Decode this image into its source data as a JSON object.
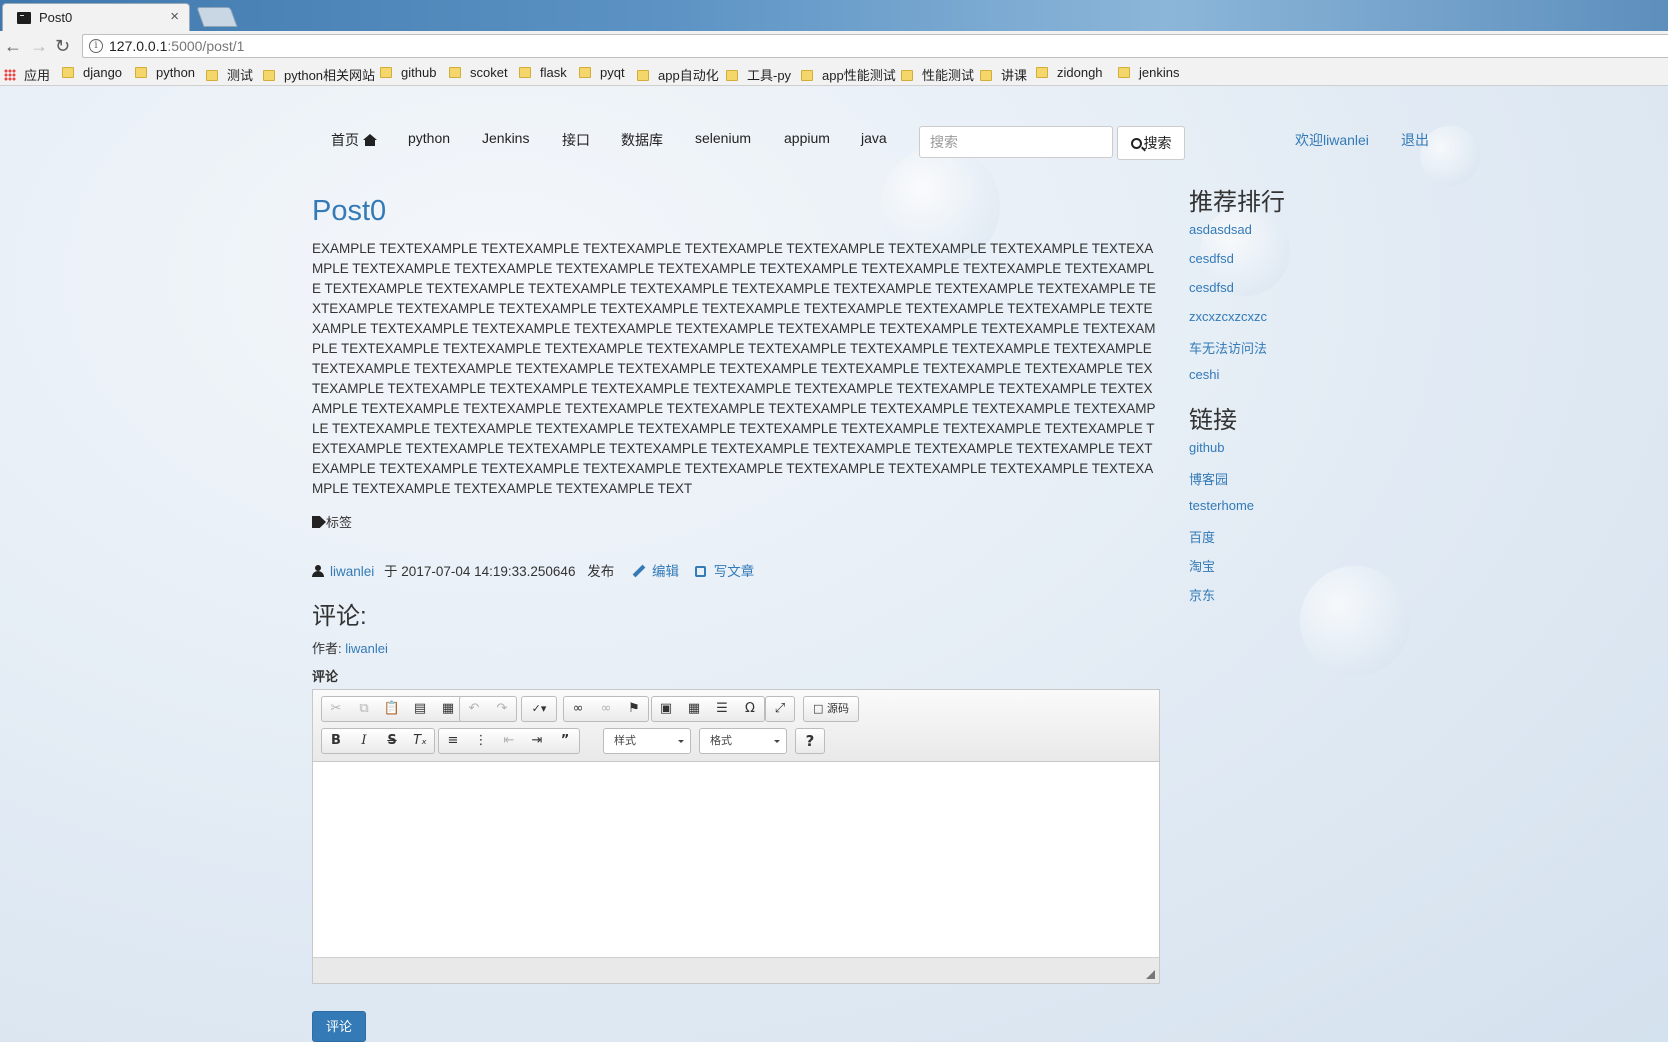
{
  "browser": {
    "tab_title": "Post0",
    "tab_close": "×",
    "url_host": "127.0.0.1",
    "url_path": ":5000/post/1",
    "bookmarks": [
      "应用",
      "django",
      "python",
      "测试",
      "python相关网站",
      "github",
      "scoket",
      "flask",
      "pyqt",
      "app自动化",
      "工具-py",
      "app性能测试",
      "性能测试",
      "讲课",
      "zidongh",
      "jenkins"
    ]
  },
  "nav": {
    "items": [
      "首页",
      "python",
      "Jenkins",
      "接口",
      "数据库",
      "selenium",
      "appium",
      "java"
    ],
    "search_placeholder": "搜索",
    "search_button": "搜索",
    "welcome": "欢迎liwanlei",
    "logout": "退出"
  },
  "post": {
    "title": "Post0",
    "body": "EXAMPLE TEXTEXAMPLE TEXTEXAMPLE TEXTEXAMPLE TEXTEXAMPLE TEXTEXAMPLE TEXTEXAMPLE TEXTEXAMPLE TEXTEXAMPLE TEXTEXAMPLE TEXTEXAMPLE TEXTEXAMPLE TEXTEXAMPLE TEXTEXAMPLE TEXTEXAMPLE TEXTEXAMPLE TEXTEXAMPLE TEXTEXAMPLE TEXTEXAMPLE TEXTEXAMPLE TEXTEXAMPLE TEXTEXAMPLE TEXTEXAMPLE TEXTEXAMPLE TEXTEXAMPLE TEXTEXAMPLE TEXTEXAMPLE TEXTEXAMPLE TEXTEXAMPLE TEXTEXAMPLE TEXTEXAMPLE TEXTEXAMPLE TEXTEXAMPLE TEXTEXAMPLE TEXTEXAMPLE TEXTEXAMPLE TEXTEXAMPLE TEXTEXAMPLE TEXTEXAMPLE TEXTEXAMPLE TEXTEXAMPLE TEXTEXAMPLE TEXTEXAMPLE TEXTEXAMPLE TEXTEXAMPLE TEXTEXAMPLE TEXTEXAMPLE TEXTEXAMPLE TEXTEXAMPLE TEXTEXAMPLE TEXTEXAMPLE TEXTEXAMPLE TEXTEXAMPLE TEXTEXAMPLE TEXTEXAMPLE TEXTEXAMPLE TEXTEXAMPLE TEXTEXAMPLE TEXTEXAMPLE TEXTEXAMPLE TEXTEXAMPLE TEXTEXAMPLE TEXTEXAMPLE TEXTEXAMPLE TEXTEXAMPLE TEXTEXAMPLE TEXTEXAMPLE TEXTEXAMPLE TEXTEXAMPLE TEXTEXAMPLE TEXTEXAMPLE TEXTEXAMPLE TEXTEXAMPLE TEXTEXAMPLE TEXTEXAMPLE TEXTEXAMPLE TEXTEXAMPLE TEXTEXAMPLE TEXTEXAMPLE TEXTEXAMPLE TEXTEXAMPLE TEXTEXAMPLE TEXTEXAMPLE TEXTEXAMPLE TEXTEXAMPLE TEXTEXAMPLE TEXTEXAMPLE TEXTEXAMPLE TEXTEXAMPLE TEXTEXAMPLE TEXTEXAMPLE TEXTEXAMPLE TEXTEXAMPLE TEXTEXAMPLE TEXTEXAMPLE TEXTEXAMPLE TEXTEXAMPLE TEXTEXAMPLE TEXTEXAMPLE TEXTEXAMPLE TEXTEXAMPLE TEXTEXAMPLE TEXTEXAMPLE TEXT",
    "tag_label": "标签",
    "author": "liwanlei",
    "date_prefix": "于 2017-07-04 14:19:33.250646",
    "published": "发布",
    "edit": "编辑",
    "write": "写文章"
  },
  "comments": {
    "heading": "评论:",
    "author_prefix": "作者:",
    "author": "liwanlei",
    "label": "评论",
    "submit": "评论"
  },
  "editor": {
    "source_label": "源码",
    "styles_label": "样式",
    "format_label": "格式",
    "help": "?"
  },
  "sidebar": {
    "ranking_title": "推荐排行",
    "ranking": [
      "asdasdsad",
      "cesdfsd",
      "cesdfsd",
      "zxcxzcxzcxzc",
      "车无法访问法",
      "ceshi"
    ],
    "links_title": "链接",
    "links": [
      "github",
      "博客园",
      "testerhome",
      "百度",
      "淘宝",
      "京东"
    ]
  }
}
